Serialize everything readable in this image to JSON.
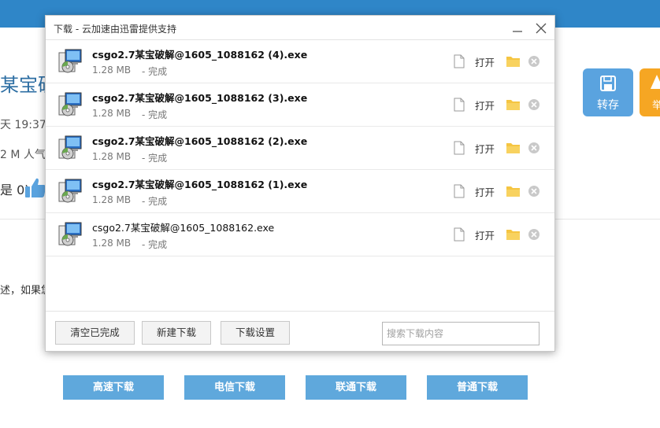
{
  "background": {
    "title_fragment": "某宝破",
    "time_fragment": "天 19:37",
    "size_fragment": "2 M   人气",
    "likes_fragment": "是 0)",
    "text_fragment": "述，如果您",
    "save_button": "转存",
    "orange_button_fragment": "举",
    "download_links": [
      "高速下载",
      "电信下载",
      "联通下载",
      "普通下载"
    ]
  },
  "dialog": {
    "title": "下载 - 云加速由迅雷提供支持",
    "files": [
      {
        "name": "csgo2.7某宝破解@1605_1088162 (4).exe",
        "size": "1.28 MB",
        "status": "- 完成",
        "open": "打开"
      },
      {
        "name": "csgo2.7某宝破解@1605_1088162 (3).exe",
        "size": "1.28 MB",
        "status": "- 完成",
        "open": "打开"
      },
      {
        "name": "csgo2.7某宝破解@1605_1088162 (2).exe",
        "size": "1.28 MB",
        "status": "- 完成",
        "open": "打开"
      },
      {
        "name": "csgo2.7某宝破解@1605_1088162 (1).exe",
        "size": "1.28 MB",
        "status": "- 完成",
        "open": "打开"
      },
      {
        "name": "csgo2.7某宝破解@1605_1088162.exe",
        "size": "1.28 MB",
        "status": "- 完成",
        "open": "打开"
      }
    ],
    "footer": {
      "clear_completed": "清空已完成",
      "new_download": "新建下载",
      "download_settings": "下载设置",
      "search_placeholder": "搜索下载内容"
    }
  },
  "colors": {
    "topbar": "#2f86c8",
    "link_button": "#5fa8dc",
    "save_button": "#5aa3df",
    "folder": "#f5c542"
  }
}
